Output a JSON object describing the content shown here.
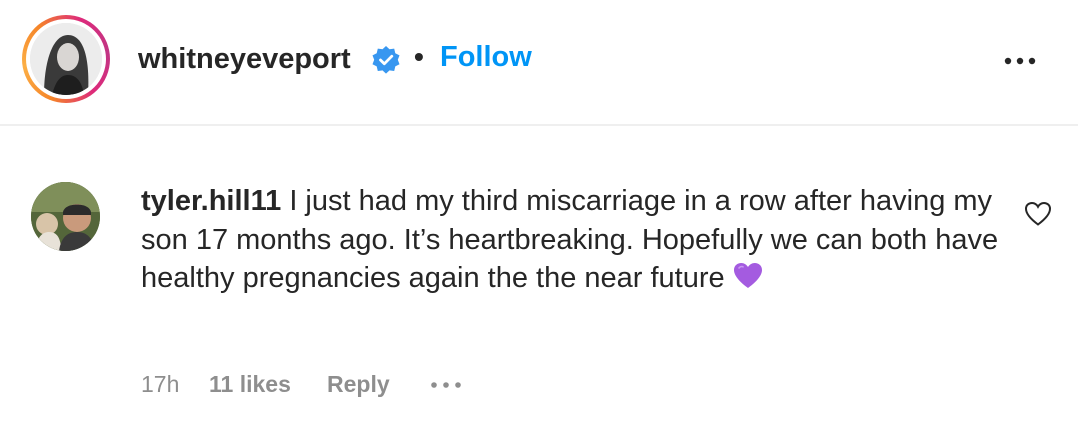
{
  "header": {
    "username": "whitneyeveport",
    "verified_icon": "verified-badge-icon",
    "separator": "•",
    "follow_label": "Follow",
    "more_icon": "more-options-icon",
    "accent_color": "#0095f6"
  },
  "comment": {
    "author": "tyler.hill11",
    "text": " I just had my third miscarriage in a row after having my son 17 months ago. It’s heartbreaking. Hopefully we can both have healthy pregnancies again the the near future ",
    "emoji_icon": "purple-heart-icon",
    "like_icon": "heart-outline-icon",
    "time": "17h",
    "likes": "11 likes",
    "reply_label": "Reply",
    "more_icon": "more-options-icon"
  }
}
